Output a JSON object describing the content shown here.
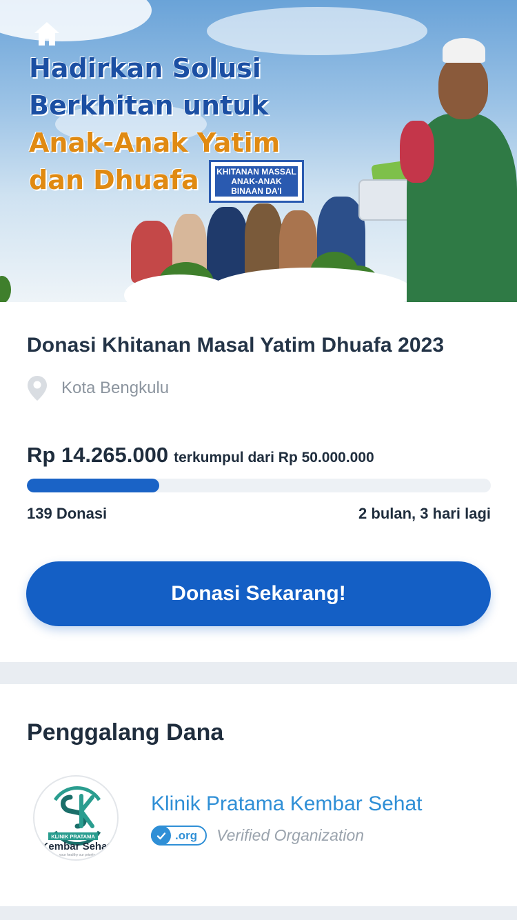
{
  "banner": {
    "headline_line1": "Hadirkan Solusi",
    "headline_line2": "Berkhitan untuk",
    "headline_line3": "Anak-Anak Yatim",
    "headline_line4": "dan Dhuafa",
    "sign_text": "KHITANAN MASSAL ANAK-ANAK BINAAN DA'I",
    "home_icon": "home-icon"
  },
  "campaign": {
    "title": "Donasi Khitanan Masal Yatim Dhuafa 2023",
    "location_icon": "location-pin-icon",
    "location": "Kota Bengkulu",
    "amount_collected": "Rp 14.265.000",
    "amount_target_text": "terkumpul dari Rp 50.000.000",
    "progress_fraction": 0.285,
    "donor_count": "139 Donasi",
    "time_remaining": "2 bulan, 3 hari lagi",
    "donate_button": "Donasi Sekarang!"
  },
  "fundraiser": {
    "section_title": "Penggalang Dana",
    "logo_text_top": "KLINIK PRATAMA",
    "logo_text_main": "Kembar Sehat",
    "logo_tagline": "your healthy our priority",
    "org_name": "Klinik Pratama Kembar Sehat",
    "badge_label": ".org",
    "verified_text": "Verified Organization"
  },
  "colors": {
    "primary": "#145fc5",
    "link": "#2f8fd6",
    "headline_blue": "#1b4fa3",
    "headline_orange": "#e08a12"
  }
}
